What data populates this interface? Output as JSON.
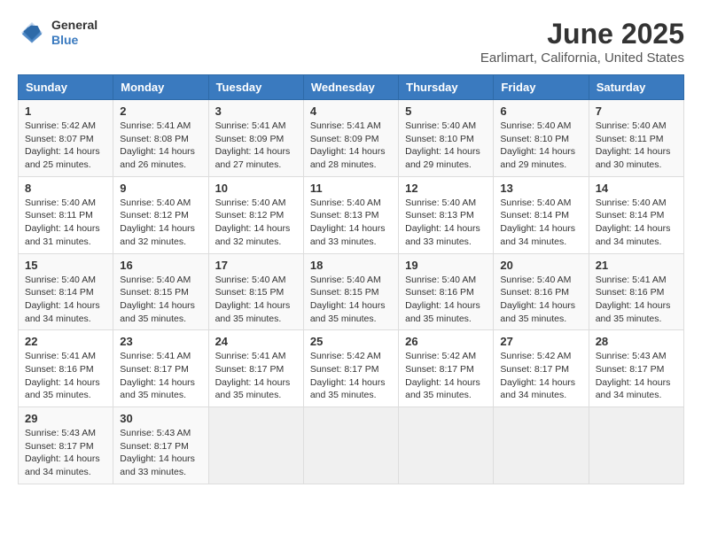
{
  "header": {
    "logo_general": "General",
    "logo_blue": "Blue",
    "title": "June 2025",
    "subtitle": "Earlimart, California, United States"
  },
  "days_of_week": [
    "Sunday",
    "Monday",
    "Tuesday",
    "Wednesday",
    "Thursday",
    "Friday",
    "Saturday"
  ],
  "weeks": [
    [
      {
        "day": "1",
        "sunrise": "5:42 AM",
        "sunset": "8:07 PM",
        "daylight": "14 hours and 25 minutes."
      },
      {
        "day": "2",
        "sunrise": "5:41 AM",
        "sunset": "8:08 PM",
        "daylight": "14 hours and 26 minutes."
      },
      {
        "day": "3",
        "sunrise": "5:41 AM",
        "sunset": "8:09 PM",
        "daylight": "14 hours and 27 minutes."
      },
      {
        "day": "4",
        "sunrise": "5:41 AM",
        "sunset": "8:09 PM",
        "daylight": "14 hours and 28 minutes."
      },
      {
        "day": "5",
        "sunrise": "5:40 AM",
        "sunset": "8:10 PM",
        "daylight": "14 hours and 29 minutes."
      },
      {
        "day": "6",
        "sunrise": "5:40 AM",
        "sunset": "8:10 PM",
        "daylight": "14 hours and 29 minutes."
      },
      {
        "day": "7",
        "sunrise": "5:40 AM",
        "sunset": "8:11 PM",
        "daylight": "14 hours and 30 minutes."
      }
    ],
    [
      {
        "day": "8",
        "sunrise": "5:40 AM",
        "sunset": "8:11 PM",
        "daylight": "14 hours and 31 minutes."
      },
      {
        "day": "9",
        "sunrise": "5:40 AM",
        "sunset": "8:12 PM",
        "daylight": "14 hours and 32 minutes."
      },
      {
        "day": "10",
        "sunrise": "5:40 AM",
        "sunset": "8:12 PM",
        "daylight": "14 hours and 32 minutes."
      },
      {
        "day": "11",
        "sunrise": "5:40 AM",
        "sunset": "8:13 PM",
        "daylight": "14 hours and 33 minutes."
      },
      {
        "day": "12",
        "sunrise": "5:40 AM",
        "sunset": "8:13 PM",
        "daylight": "14 hours and 33 minutes."
      },
      {
        "day": "13",
        "sunrise": "5:40 AM",
        "sunset": "8:14 PM",
        "daylight": "14 hours and 34 minutes."
      },
      {
        "day": "14",
        "sunrise": "5:40 AM",
        "sunset": "8:14 PM",
        "daylight": "14 hours and 34 minutes."
      }
    ],
    [
      {
        "day": "15",
        "sunrise": "5:40 AM",
        "sunset": "8:14 PM",
        "daylight": "14 hours and 34 minutes."
      },
      {
        "day": "16",
        "sunrise": "5:40 AM",
        "sunset": "8:15 PM",
        "daylight": "14 hours and 35 minutes."
      },
      {
        "day": "17",
        "sunrise": "5:40 AM",
        "sunset": "8:15 PM",
        "daylight": "14 hours and 35 minutes."
      },
      {
        "day": "18",
        "sunrise": "5:40 AM",
        "sunset": "8:15 PM",
        "daylight": "14 hours and 35 minutes."
      },
      {
        "day": "19",
        "sunrise": "5:40 AM",
        "sunset": "8:16 PM",
        "daylight": "14 hours and 35 minutes."
      },
      {
        "day": "20",
        "sunrise": "5:40 AM",
        "sunset": "8:16 PM",
        "daylight": "14 hours and 35 minutes."
      },
      {
        "day": "21",
        "sunrise": "5:41 AM",
        "sunset": "8:16 PM",
        "daylight": "14 hours and 35 minutes."
      }
    ],
    [
      {
        "day": "22",
        "sunrise": "5:41 AM",
        "sunset": "8:16 PM",
        "daylight": "14 hours and 35 minutes."
      },
      {
        "day": "23",
        "sunrise": "5:41 AM",
        "sunset": "8:17 PM",
        "daylight": "14 hours and 35 minutes."
      },
      {
        "day": "24",
        "sunrise": "5:41 AM",
        "sunset": "8:17 PM",
        "daylight": "14 hours and 35 minutes."
      },
      {
        "day": "25",
        "sunrise": "5:42 AM",
        "sunset": "8:17 PM",
        "daylight": "14 hours and 35 minutes."
      },
      {
        "day": "26",
        "sunrise": "5:42 AM",
        "sunset": "8:17 PM",
        "daylight": "14 hours and 35 minutes."
      },
      {
        "day": "27",
        "sunrise": "5:42 AM",
        "sunset": "8:17 PM",
        "daylight": "14 hours and 34 minutes."
      },
      {
        "day": "28",
        "sunrise": "5:43 AM",
        "sunset": "8:17 PM",
        "daylight": "14 hours and 34 minutes."
      }
    ],
    [
      {
        "day": "29",
        "sunrise": "5:43 AM",
        "sunset": "8:17 PM",
        "daylight": "14 hours and 34 minutes."
      },
      {
        "day": "30",
        "sunrise": "5:43 AM",
        "sunset": "8:17 PM",
        "daylight": "14 hours and 33 minutes."
      },
      null,
      null,
      null,
      null,
      null
    ]
  ]
}
